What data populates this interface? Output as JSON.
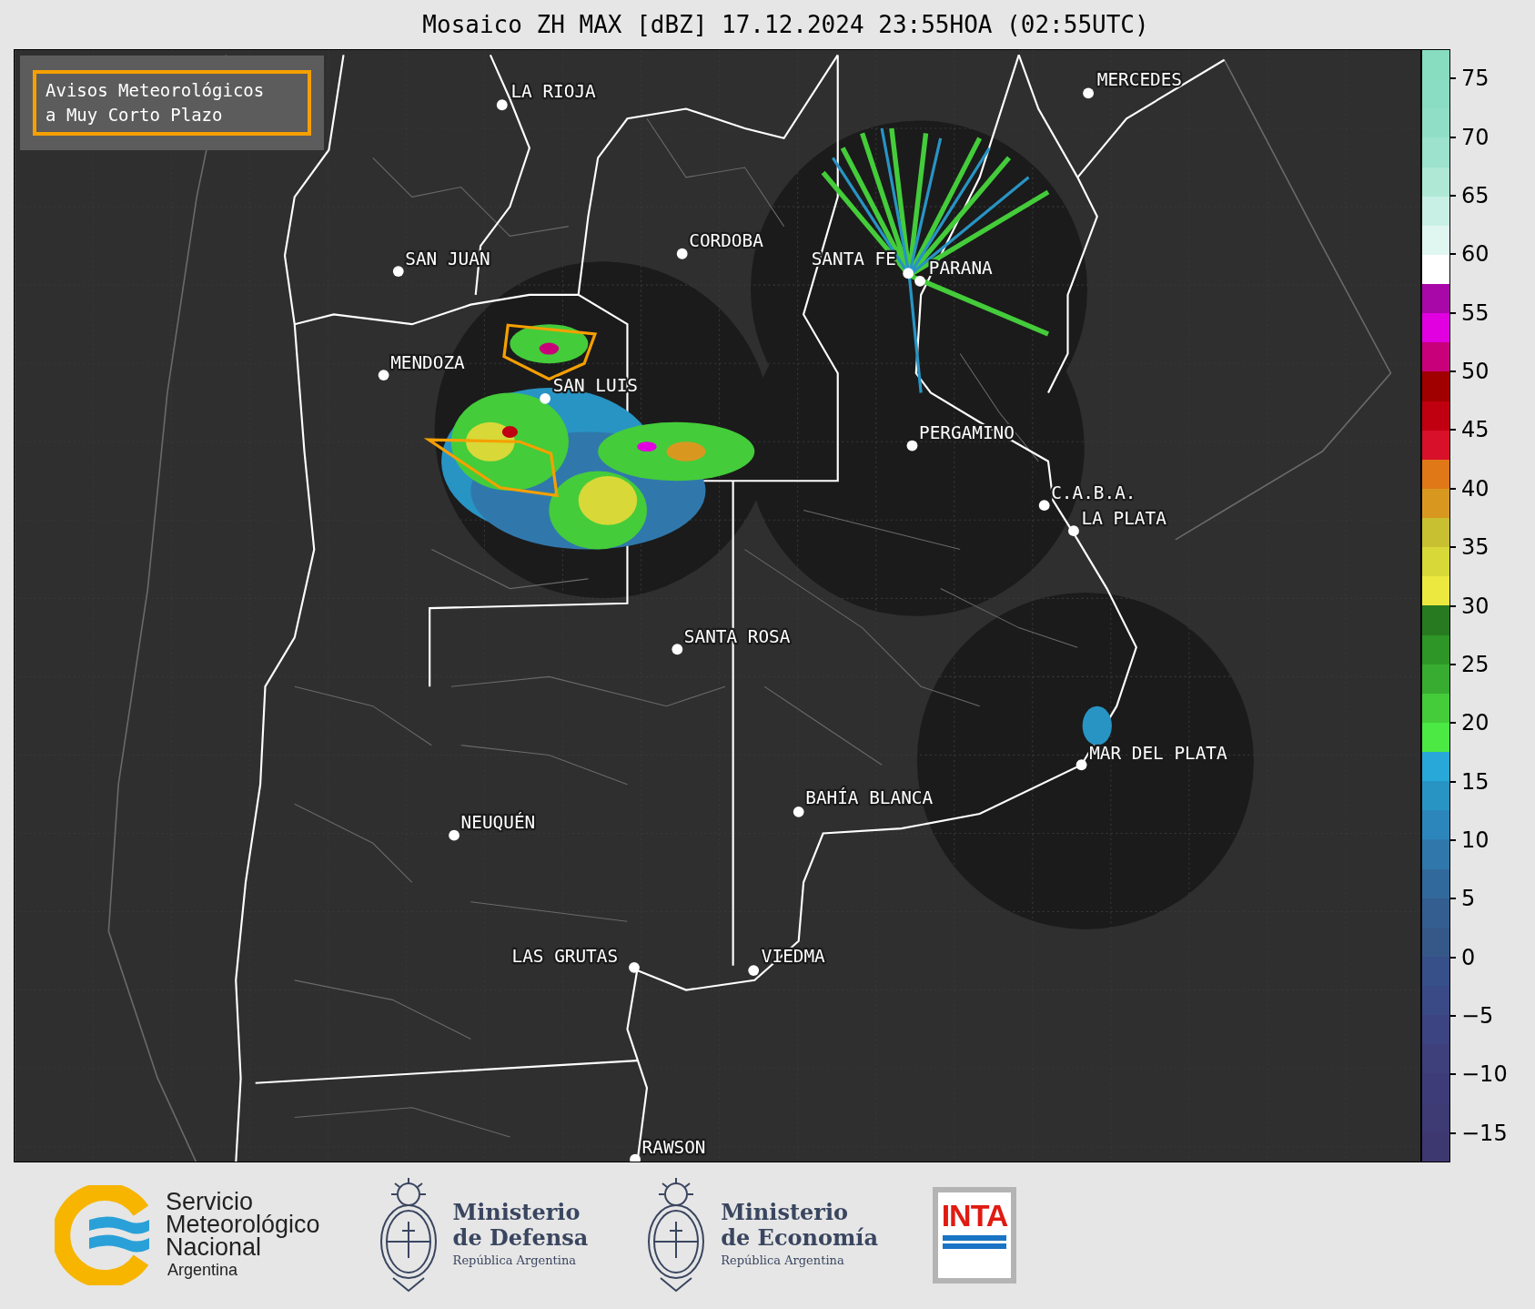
{
  "title": "Mosaico ZH MAX [dBZ] 17.12.2024 23:55HOA (02:55UTC)",
  "map": {
    "legend": {
      "lines": [
        "Avisos Meteorológicos",
        "a Muy Corto Plazo"
      ]
    },
    "cities": [
      {
        "name": "LA RIOJA"
      },
      {
        "name": "MERCEDES"
      },
      {
        "name": "CORDOBA"
      },
      {
        "name": "SAN JUAN"
      },
      {
        "name": "SANTA FE"
      },
      {
        "name": "PARANA"
      },
      {
        "name": "MENDOZA"
      },
      {
        "name": "SAN LUIS"
      },
      {
        "name": "PERGAMINO"
      },
      {
        "name": "C.A.B.A."
      },
      {
        "name": "LA PLATA"
      },
      {
        "name": "SANTA ROSA"
      },
      {
        "name": "MAR DEL PLATA"
      },
      {
        "name": "BAHÍA BLANCA"
      },
      {
        "name": "NEUQUÉN"
      },
      {
        "name": "LAS GRUTAS"
      },
      {
        "name": "VIEDMA"
      },
      {
        "name": "RAWSON"
      }
    ]
  },
  "colorbar": {
    "segments": [
      {
        "color": "#88dcc0"
      },
      {
        "color": "#8adcc2"
      },
      {
        "color": "#90dec6"
      },
      {
        "color": "#9ce2cc"
      },
      {
        "color": "#b0e8d6"
      },
      {
        "color": "#c8f0e4"
      },
      {
        "color": "#e0f6f0"
      },
      {
        "color": "#ffffff"
      },
      {
        "color": "#a808a8"
      },
      {
        "color": "#e000e0"
      },
      {
        "color": "#c8007a"
      },
      {
        "color": "#a00000"
      },
      {
        "color": "#c00010"
      },
      {
        "color": "#d8102a"
      },
      {
        "color": "#e07818"
      },
      {
        "color": "#d89820"
      },
      {
        "color": "#c8c030"
      },
      {
        "color": "#d8d838"
      },
      {
        "color": "#ece840"
      },
      {
        "color": "#287a20"
      },
      {
        "color": "#2e9626"
      },
      {
        "color": "#38ac30"
      },
      {
        "color": "#44cc3a"
      },
      {
        "color": "#4ce844"
      },
      {
        "color": "#28a8d8"
      },
      {
        "color": "#2894c4"
      },
      {
        "color": "#2c86bc"
      },
      {
        "color": "#3078ac"
      },
      {
        "color": "#32699c"
      },
      {
        "color": "#345e90"
      },
      {
        "color": "#365888"
      },
      {
        "color": "#38508a"
      },
      {
        "color": "#3a4a86"
      },
      {
        "color": "#3c4482"
      },
      {
        "color": "#3e407c"
      },
      {
        "color": "#3e3c78"
      },
      {
        "color": "#3e3a74"
      },
      {
        "color": "#3e3870"
      }
    ],
    "ticks": [
      "75",
      "70",
      "65",
      "60",
      "55",
      "50",
      "45",
      "40",
      "35",
      "30",
      "25",
      "20",
      "15",
      "10",
      "5",
      "0",
      "−5",
      "−10",
      "−15"
    ]
  },
  "footer": {
    "logos": [
      {
        "kind": "smn",
        "lines": [
          "Servicio",
          "Meteorológico",
          "Nacional"
        ],
        "subtitle": "Argentina"
      },
      {
        "kind": "ministry",
        "lines": [
          "Ministerio",
          "de Defensa"
        ],
        "subtitle": "República Argentina"
      },
      {
        "kind": "ministry",
        "lines": [
          "Ministerio",
          "de Economía"
        ],
        "subtitle": "República Argentina"
      },
      {
        "kind": "inta",
        "lines": [
          "INTA"
        ]
      }
    ]
  }
}
